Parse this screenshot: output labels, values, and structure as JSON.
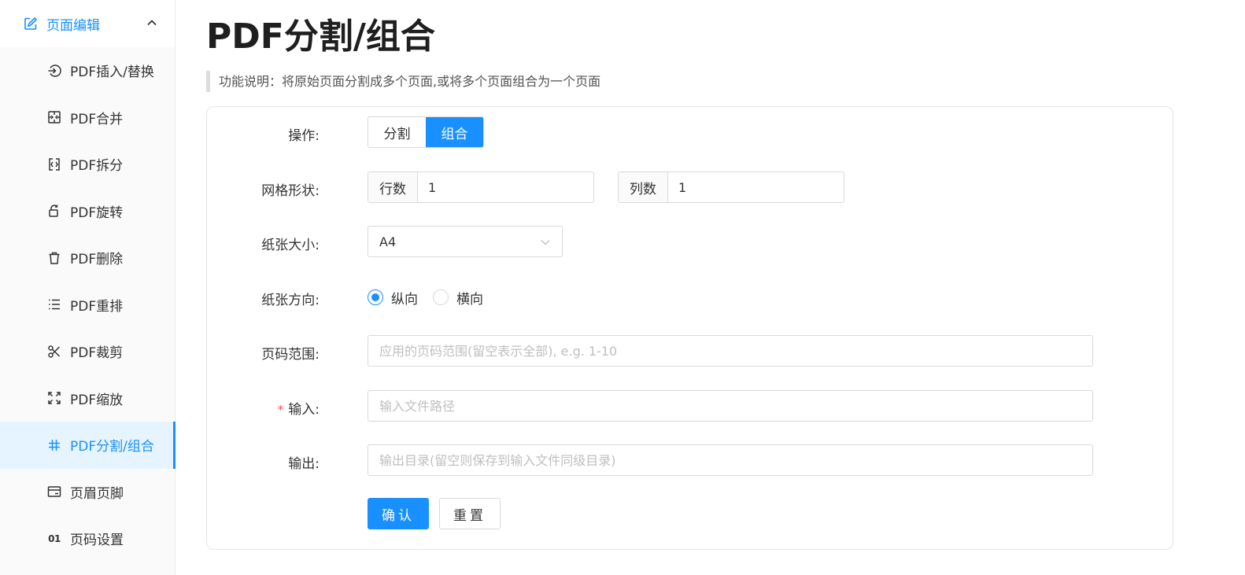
{
  "sidebar": {
    "group": {
      "label": "页面编辑",
      "icon": "edit-icon",
      "expanded": true
    },
    "items": [
      {
        "label": "PDF插入/替换",
        "icon": "login-icon"
      },
      {
        "label": "PDF合并",
        "icon": "merge-icon"
      },
      {
        "label": "PDF拆分",
        "icon": "split-icon"
      },
      {
        "label": "PDF旋转",
        "icon": "rotate-icon"
      },
      {
        "label": "PDF删除",
        "icon": "trash-icon"
      },
      {
        "label": "PDF重排",
        "icon": "list-icon"
      },
      {
        "label": "PDF裁剪",
        "icon": "scissors-icon"
      },
      {
        "label": "PDF缩放",
        "icon": "expand-icon"
      },
      {
        "label": "PDF分割/组合",
        "icon": "grid-icon",
        "active": true
      },
      {
        "label": "页眉页脚",
        "icon": "header-footer-icon"
      },
      {
        "label": "页码设置",
        "icon": "page-number-icon",
        "icon_text": "01"
      }
    ]
  },
  "main": {
    "title": "PDF分割/组合",
    "description": "功能说明：将原始页面分割成多个页面,或将多个页面组合为一个页面"
  },
  "form": {
    "operation": {
      "label": "操作:",
      "options": [
        "分割",
        "组合"
      ],
      "selected": "组合"
    },
    "grid": {
      "label": "网格形状:",
      "rows_label": "行数",
      "rows_value": "1",
      "cols_label": "列数",
      "cols_value": "1"
    },
    "paper_size": {
      "label": "纸张大小:",
      "value": "A4"
    },
    "orientation": {
      "label": "纸张方向:",
      "options": [
        "纵向",
        "横向"
      ],
      "selected": "纵向"
    },
    "page_range": {
      "label": "页码范围:",
      "placeholder": "应用的页码范围(留空表示全部), e.g. 1-10"
    },
    "input": {
      "required_mark": "*",
      "label": "输入:",
      "placeholder": "输入文件路径"
    },
    "output": {
      "label": "输出:",
      "placeholder": "输出目录(留空则保存到输入文件同级目录)"
    },
    "confirm_label": "确认",
    "reset_label": "重置"
  },
  "colors": {
    "accent": "#1890ff",
    "active_bg": "#e6f4ff",
    "required": "#ff4d4f"
  }
}
